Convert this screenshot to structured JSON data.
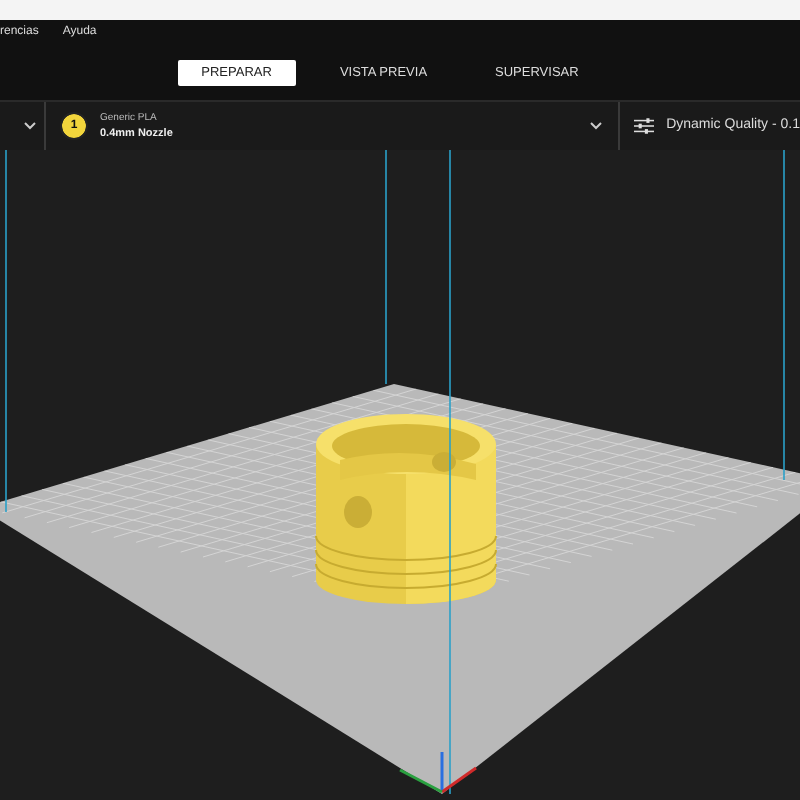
{
  "menu": [
    {
      "label": "rencias"
    },
    {
      "label": "Ayuda"
    }
  ],
  "tabs": [
    {
      "label": "PREPARAR",
      "selected": true
    },
    {
      "label": "VISTA PREVIA",
      "selected": false
    },
    {
      "label": "SUPERVISAR",
      "selected": false
    }
  ],
  "material": {
    "extruder": "1",
    "name": "Generic PLA",
    "nozzle": "0.4mm Nozzle"
  },
  "profile": {
    "label": "Dynamic Quality - 0.1"
  }
}
